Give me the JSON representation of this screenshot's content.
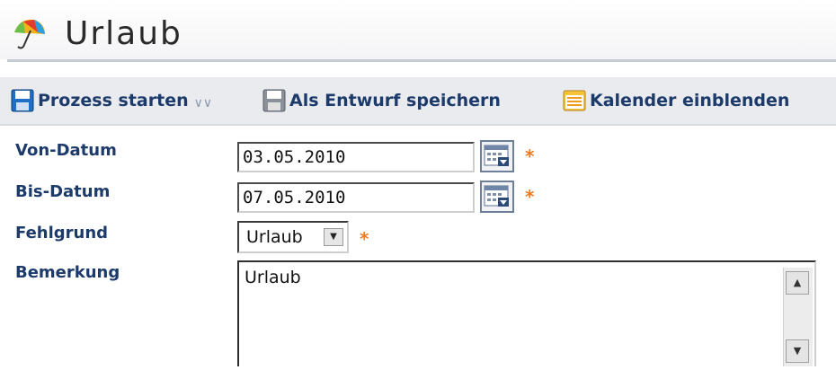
{
  "header": {
    "title": "Urlaub",
    "app_icon": "umbrella-icon"
  },
  "toolbar": {
    "start_label": "Prozess starten",
    "draft_label": "Als Entwurf speichern",
    "calendar_label": "Kalender einblenden"
  },
  "form": {
    "from_label": "Von-Datum",
    "from_value": "03.05.2010",
    "to_label": "Bis-Datum",
    "to_value": "07.05.2010",
    "reason_label": "Fehlgrund",
    "reason_value": "Urlaub",
    "comment_label": "Bemerkung",
    "comment_value": "Urlaub",
    "required_marker": "*"
  },
  "colors": {
    "label": "#1c3a6a",
    "required": "#f07a1e",
    "toolbar_bg": "#e9ebef"
  }
}
